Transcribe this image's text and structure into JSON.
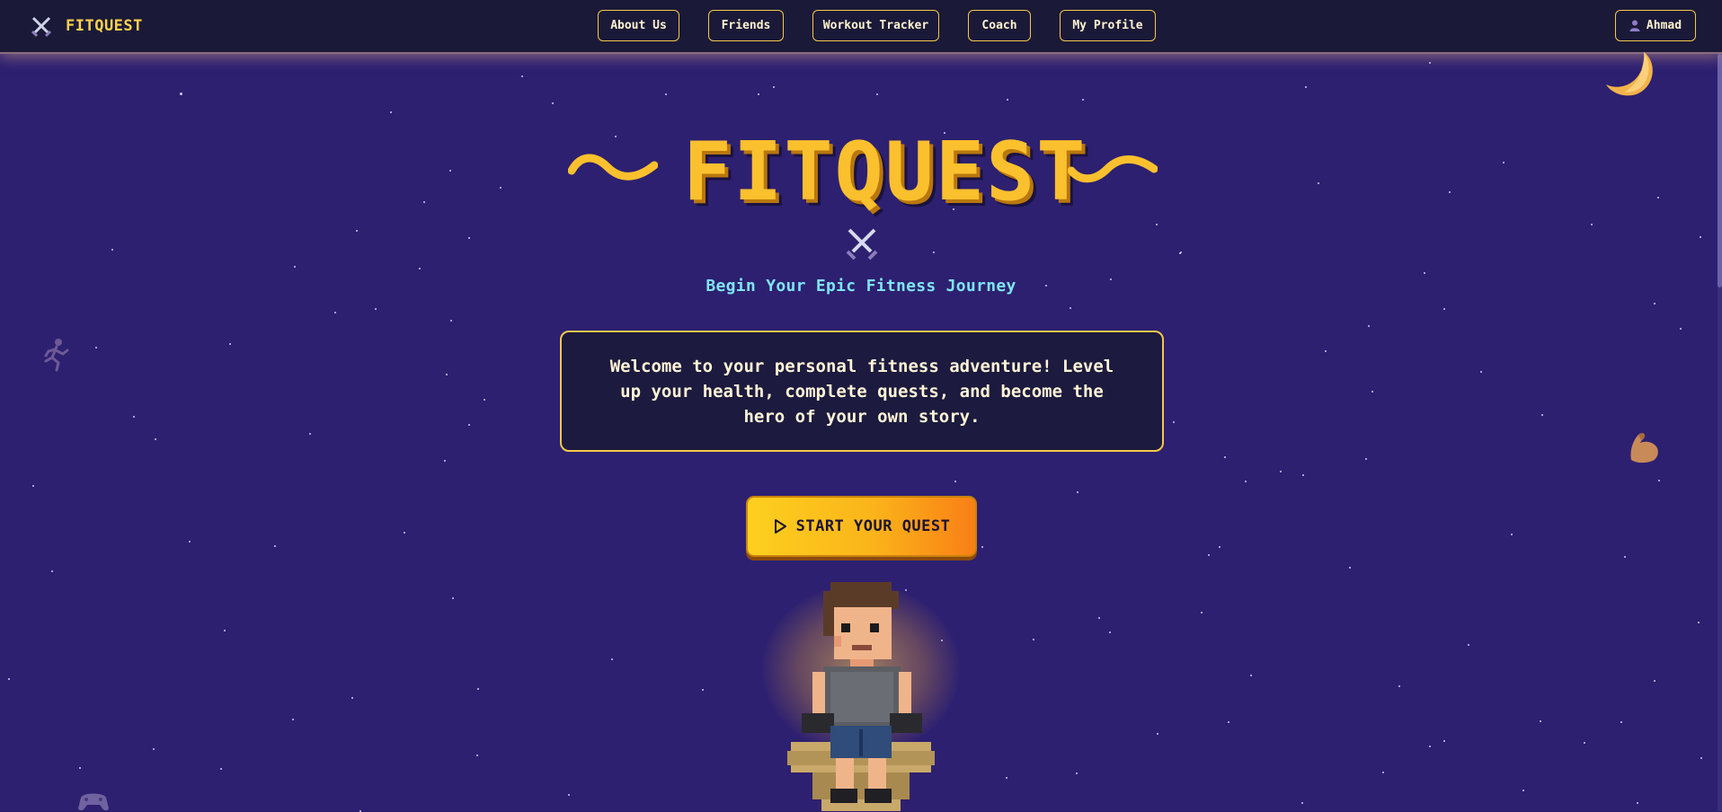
{
  "app": {
    "brand_name": "FITQUEST",
    "brand_icon": "crossed-swords-icon"
  },
  "nav": {
    "items": [
      {
        "label": "About Us"
      },
      {
        "label": "Friends"
      },
      {
        "label": "Workout Tracker"
      },
      {
        "label": "Coach"
      },
      {
        "label": "My Profile"
      }
    ],
    "user": {
      "name": "Ahmad",
      "icon": "user-icon"
    }
  },
  "hero": {
    "title": "FITQUEST",
    "title_icon": "crossed-swords-icon",
    "tagline": "Begin Your Epic Fitness Journey",
    "welcome": "Welcome to your personal fitness adventure! Level up your health, complete quests, and become the hero of your own story.",
    "cta_label": "START YOUR QUEST",
    "cta_icon": "play-icon"
  },
  "decorations": {
    "icons": [
      "moon-icon",
      "runner-icon",
      "muscle-icon",
      "game-controller-icon",
      "hero-character"
    ]
  },
  "colors": {
    "background": "#2d2070",
    "navbar": "#1b1938",
    "accent_gold": "#fbc02d",
    "tagline_cyan": "#7fe3f5",
    "cta_gradient_start": "#fcd01f",
    "cta_gradient_end": "#f97f16"
  }
}
